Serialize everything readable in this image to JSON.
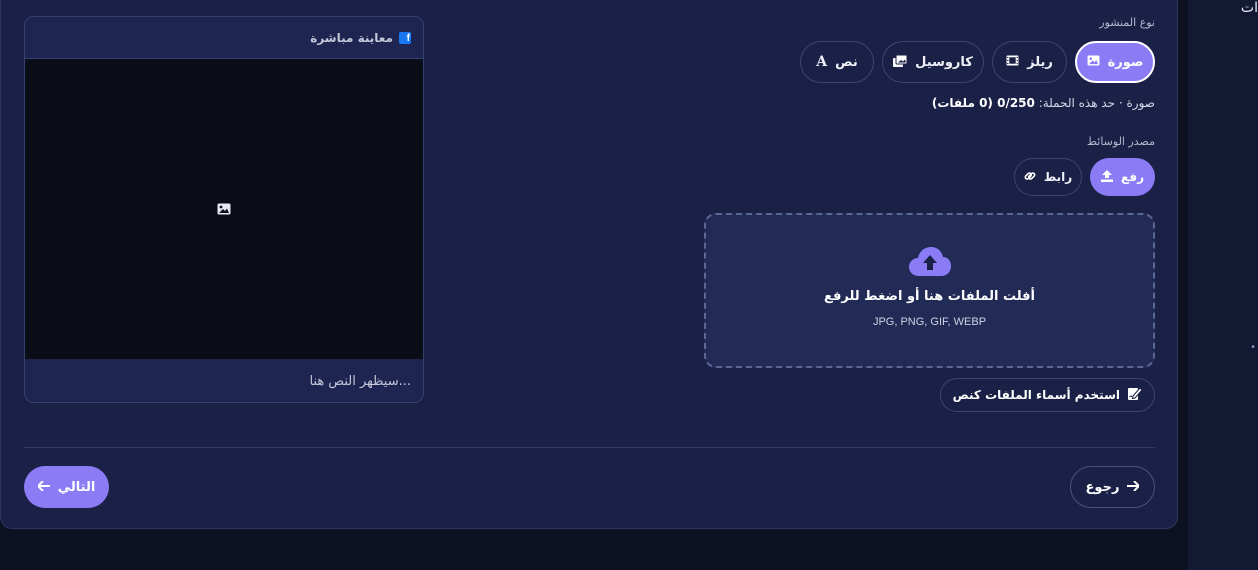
{
  "sidebar_cut_text": "ات",
  "preview": {
    "title": "معاينة مباشرة",
    "placeholder_text": "سيظهر النص هنا..."
  },
  "post_type": {
    "label": "نوع المنشور",
    "options": [
      {
        "label": "صورة",
        "icon": "image-icon",
        "active": true
      },
      {
        "label": "ريلز",
        "icon": "film-icon",
        "active": false
      },
      {
        "label": "كاروسيل",
        "icon": "images-icon",
        "active": false
      },
      {
        "label": "نص",
        "icon": "text-icon",
        "active": false
      }
    ]
  },
  "limit": {
    "prefix": "صورة · حد هذه الحملة: ",
    "count": "0/250",
    "suffix": " (0 ملفات)"
  },
  "media_source": {
    "label": "مصدر الوسائط",
    "options": [
      {
        "label": "رفع",
        "icon": "upload-icon",
        "active": true
      },
      {
        "label": "رابط",
        "icon": "link-icon",
        "active": false
      }
    ]
  },
  "dropzone": {
    "title": "أفلت الملفات هنا أو اضغط للرفع",
    "formats": "JPG, PNG, GIF, WEBP"
  },
  "filenames_button": "استخدم أسماء الملفات كنص",
  "footer": {
    "back_label": "رجوع",
    "next_label": "التالي"
  },
  "colors": {
    "accent": "#8b7cf6",
    "card_bg": "#1b2146",
    "page_bg": "#0d1122",
    "facebook": "#1877f2"
  }
}
